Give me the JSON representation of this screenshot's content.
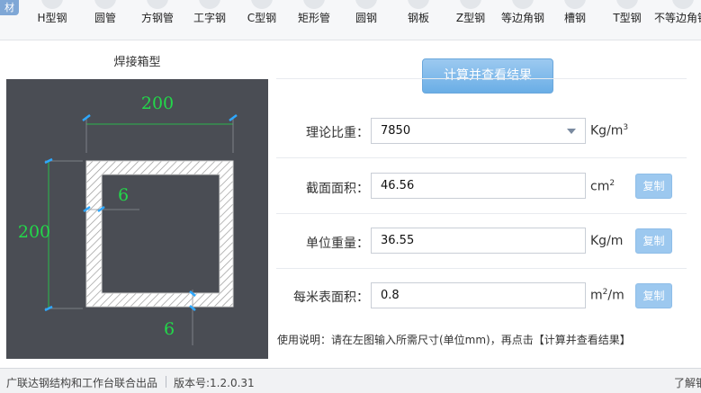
{
  "toolbar": {
    "tab_label": "材",
    "items": [
      {
        "label": "H型钢",
        "icon": "h-beam-icon"
      },
      {
        "label": "圆管",
        "icon": "round-tube-icon"
      },
      {
        "label": "方钢管",
        "icon": "square-tube-icon"
      },
      {
        "label": "工字钢",
        "icon": "i-beam-icon"
      },
      {
        "label": "C型钢",
        "icon": "c-channel-icon"
      },
      {
        "label": "矩形管",
        "icon": "rect-tube-icon"
      },
      {
        "label": "圆钢",
        "icon": "round-bar-icon"
      },
      {
        "label": "钢板",
        "icon": "steel-plate-icon"
      },
      {
        "label": "Z型钢",
        "icon": "z-section-icon"
      },
      {
        "label": "等边角钢",
        "icon": "equal-angle-icon"
      },
      {
        "label": "槽钢",
        "icon": "channel-icon"
      },
      {
        "label": "T型钢",
        "icon": "t-section-icon"
      },
      {
        "label": "不等边角钢",
        "icon": "unequal-angle-icon"
      }
    ]
  },
  "drawing": {
    "title": "焊接箱型",
    "width_value": "200",
    "height_value": "200",
    "web_thickness": "6",
    "flange_thickness": "6",
    "dimension_color": "#22d94a",
    "background_color": "#4a4d54"
  },
  "form": {
    "calc_button": "计算并查看结果",
    "density_label": "理论比重：",
    "density_value": "7850",
    "density_unit_base": "Kg/m",
    "density_unit_exp": "3",
    "area_label": "截面面积：",
    "area_value": "46.56",
    "area_unit_base": "cm",
    "area_unit_exp": "2",
    "weight_label": "单位重量：",
    "weight_value": "36.55",
    "weight_unit": "Kg/m",
    "surface_label": "每米表面积：",
    "surface_value": "0.8",
    "surface_unit_base": "m",
    "surface_unit_exp": "2",
    "surface_unit_tail": "/m",
    "copy_label": "复制",
    "note": "使用说明：请在左图输入所需尺寸(单位mm)，再点击【计算并查看结果】"
  },
  "status": {
    "credit": "广联达钢结构和工作台联合出品",
    "version": "版本号:1.2.0.31",
    "right_link": "了解钢"
  },
  "colors": {
    "accent": "#6aaee6",
    "copy_button": "#9cc8ef"
  }
}
